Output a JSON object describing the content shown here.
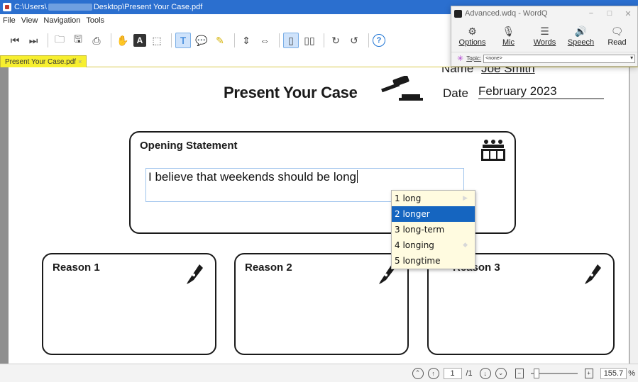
{
  "titlebar": {
    "path_prefix": "C:\\Users\\",
    "path_suffix": "Desktop\\Present Your Case.pdf"
  },
  "menu": [
    "File",
    "View",
    "Navigation",
    "Tools"
  ],
  "tab": {
    "label": "Present Your Case.pdf"
  },
  "document": {
    "name_label": "Name",
    "name_value": "Joe Smith",
    "title": "Present Your Case",
    "date_label": "Date",
    "date_value": "February 2023",
    "opening": {
      "title": "Opening Statement",
      "text": "I believe that weekends should be long"
    },
    "reasons": [
      "Reason 1",
      "Reason 2",
      "Reason 3"
    ]
  },
  "prediction": {
    "items": [
      {
        "num": "1",
        "word": "long"
      },
      {
        "num": "2",
        "word": "longer"
      },
      {
        "num": "3",
        "word": "long-term"
      },
      {
        "num": "4",
        "word": "longing"
      },
      {
        "num": "5",
        "word": "longtime"
      }
    ],
    "selected_index": 1
  },
  "statusbar": {
    "page_current": "1",
    "page_total": "/1",
    "zoom": "155.7",
    "zoom_unit": "%"
  },
  "wordq": {
    "title": "Advanced.wdq - WordQ",
    "buttons": [
      {
        "label": "Options",
        "icon": "gear-icon"
      },
      {
        "label": "Mic",
        "icon": "microphone-icon"
      },
      {
        "label": "Words",
        "icon": "list-icon"
      },
      {
        "label": "Speech",
        "icon": "speaker-icon"
      },
      {
        "label": "Read",
        "icon": "speech-bubble-icon"
      }
    ],
    "topic_label": "Topic:",
    "topic_value": "<none>"
  }
}
